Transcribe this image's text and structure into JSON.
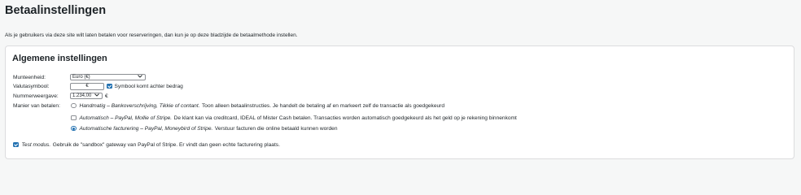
{
  "page": {
    "title": "Betaalinstellingen",
    "intro": "Als je gebruikers via deze site wilt laten betalen voor reserveringen, dan kun je op deze bladzijde de betaalmethode instellen."
  },
  "panel": {
    "title": "Algemene instellingen",
    "currency": {
      "label": "Munteenheid:",
      "selected": "Euro (€)"
    },
    "symbol": {
      "label": "Valutasymbool:",
      "value": "€",
      "after_checked": true,
      "after_label": "Symbool komt achter bedrag"
    },
    "number_format": {
      "label": "Nummerweergave:",
      "selected": "1.234,00",
      "suffix": "€"
    },
    "payment": {
      "label": "Manier van betalen:",
      "options": [
        {
          "checked": false,
          "title": "Handmatig – Bankoverschrijving, Tikkie of contant.",
          "desc": "Toon alleen betaalinstructies. Je handelt de betaling af en markeert zelf de transactie als goedgekeurd"
        },
        {
          "checked": false,
          "title": "Automatisch – PayPal, Mollie of Stripe.",
          "desc": "De klant kan via creditcard, IDEAL of Mister Cash betalen. Transacties worden automatisch goedgekeurd als het geld op je rekening binnenkomt"
        },
        {
          "checked": true,
          "title": "Automatische facturering – PayPal, Moneybird of Stripe.",
          "desc": "Verstuur facturen die online betaald kunnen worden"
        }
      ]
    },
    "test_mode": {
      "checked": true,
      "title": "Test modus.",
      "desc": "Gebruik de \"sandbox\" gateway van PayPal of Stripe. Er vindt dan geen echte facturering plaats."
    }
  },
  "colors": {
    "accent": "#2271b1",
    "background": "#f6f7f7",
    "panel": "#ffffff",
    "border": "#dcdcde",
    "text": "#1d2327"
  },
  "icons": {
    "select_arrow": "chevron-down-icon",
    "checkmark": "checkmark-icon"
  }
}
